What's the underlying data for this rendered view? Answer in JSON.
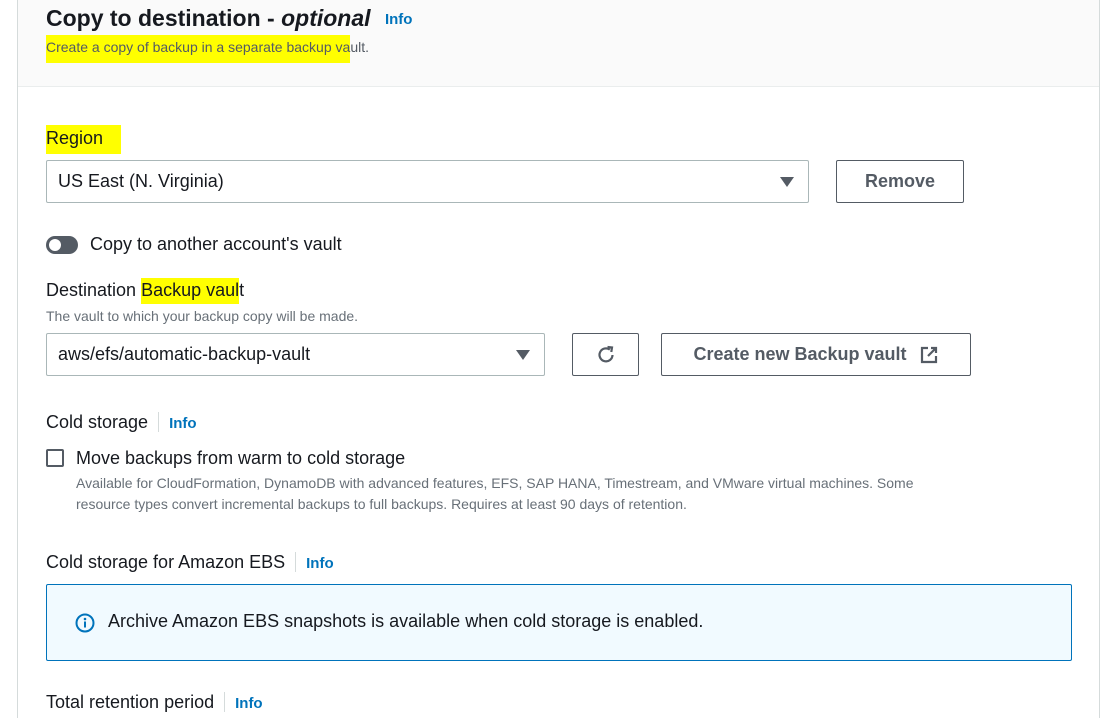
{
  "section": {
    "title": "Copy to destination - ",
    "title_optional": "optional",
    "info_label": "Info",
    "description_highlighted": "Create a copy of backup in a separate backup va",
    "description_rest": "ult."
  },
  "region": {
    "label": "Region",
    "selected": "US East (N. Virginia)",
    "remove_label": "Remove"
  },
  "cross_account": {
    "label": "Copy to another account's vault",
    "enabled": false
  },
  "destination_vault": {
    "label_prefix": "Destination ",
    "label_highlighted": "Backup vaul",
    "label_suffix": "t",
    "description": "The vault to which your backup copy will be made.",
    "selected": "aws/efs/automatic-backup-vault",
    "create_label": "Create new Backup vault"
  },
  "cold_storage": {
    "label": "Cold storage",
    "info_label": "Info",
    "checkbox_label": "Move backups from warm to cold storage",
    "checked": false,
    "help_line1": "Available for CloudFormation, DynamoDB with advanced features, EFS, SAP HANA, Timestream, and VMware virtual machines. Some",
    "help_line2": "resource types convert incremental backups to full backups. Requires at least 90 days of retention."
  },
  "cold_storage_ebs": {
    "label": "Cold storage for Amazon EBS",
    "info_label": "Info",
    "alert_text": "Archive Amazon EBS snapshots is available when cold storage is enabled."
  },
  "retention": {
    "label": "Total retention period",
    "info_label": "Info"
  },
  "colors": {
    "highlight": "#ffff00",
    "link": "#0073bb",
    "alert_border": "#0073bb",
    "alert_bg": "#f1faff"
  },
  "icons": [
    "caret-down-icon",
    "refresh-icon",
    "external-link-icon",
    "info-circle-icon"
  ]
}
